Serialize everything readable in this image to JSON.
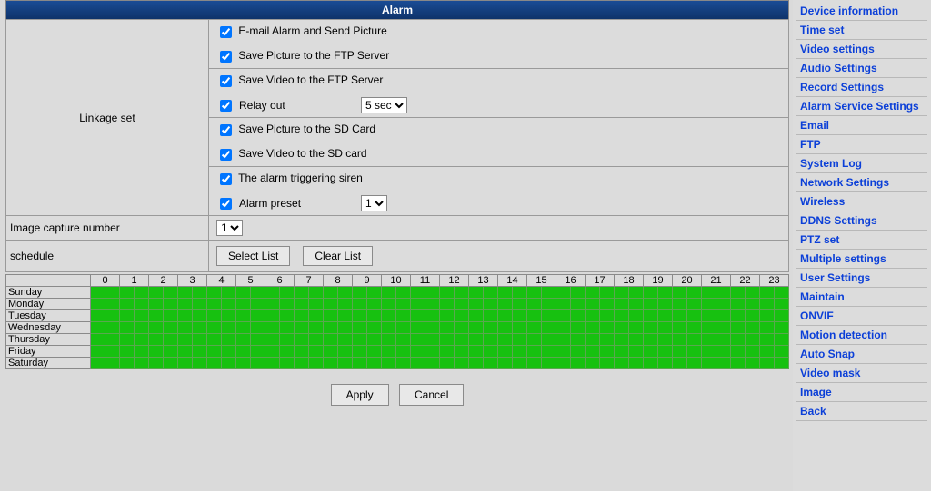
{
  "title": "Alarm",
  "linkage_label": "Linkage set",
  "linkage": {
    "email": {
      "label": "E-mail Alarm and Send Picture",
      "checked": true
    },
    "ftp_pic": {
      "label": "Save Picture to the FTP Server",
      "checked": true
    },
    "ftp_vid": {
      "label": "Save Video to the FTP Server",
      "checked": true
    },
    "relay": {
      "label": "Relay out",
      "checked": true,
      "value": "5 sec"
    },
    "sd_pic": {
      "label": "Save Picture to the SD Card",
      "checked": true
    },
    "sd_vid": {
      "label": "Save Video to the SD card",
      "checked": true
    },
    "siren": {
      "label": "The alarm triggering siren",
      "checked": true
    },
    "preset": {
      "label": "Alarm preset",
      "checked": true,
      "value": "1"
    }
  },
  "capture": {
    "label": "Image capture number",
    "value": "1"
  },
  "schedule": {
    "label": "schedule",
    "select_btn": "Select List",
    "clear_btn": "Clear List"
  },
  "hours": [
    "0",
    "1",
    "2",
    "3",
    "4",
    "5",
    "6",
    "7",
    "8",
    "9",
    "10",
    "11",
    "12",
    "13",
    "14",
    "15",
    "16",
    "17",
    "18",
    "19",
    "20",
    "21",
    "22",
    "23"
  ],
  "days": [
    "Sunday",
    "Monday",
    "Tuesday",
    "Wednesday",
    "Thursday",
    "Friday",
    "Saturday"
  ],
  "footer": {
    "apply": "Apply",
    "cancel": "Cancel"
  },
  "sidebar": [
    "Device information",
    "Time set",
    "Video settings",
    "Audio Settings",
    "Record Settings",
    "Alarm Service Settings",
    "Email",
    "FTP",
    "System Log",
    "Network Settings",
    "Wireless",
    "DDNS Settings",
    "PTZ set",
    "Multiple settings",
    "User Settings",
    "Maintain",
    "ONVIF",
    "Motion detection",
    "Auto Snap",
    "Video mask",
    "Image",
    "Back"
  ]
}
